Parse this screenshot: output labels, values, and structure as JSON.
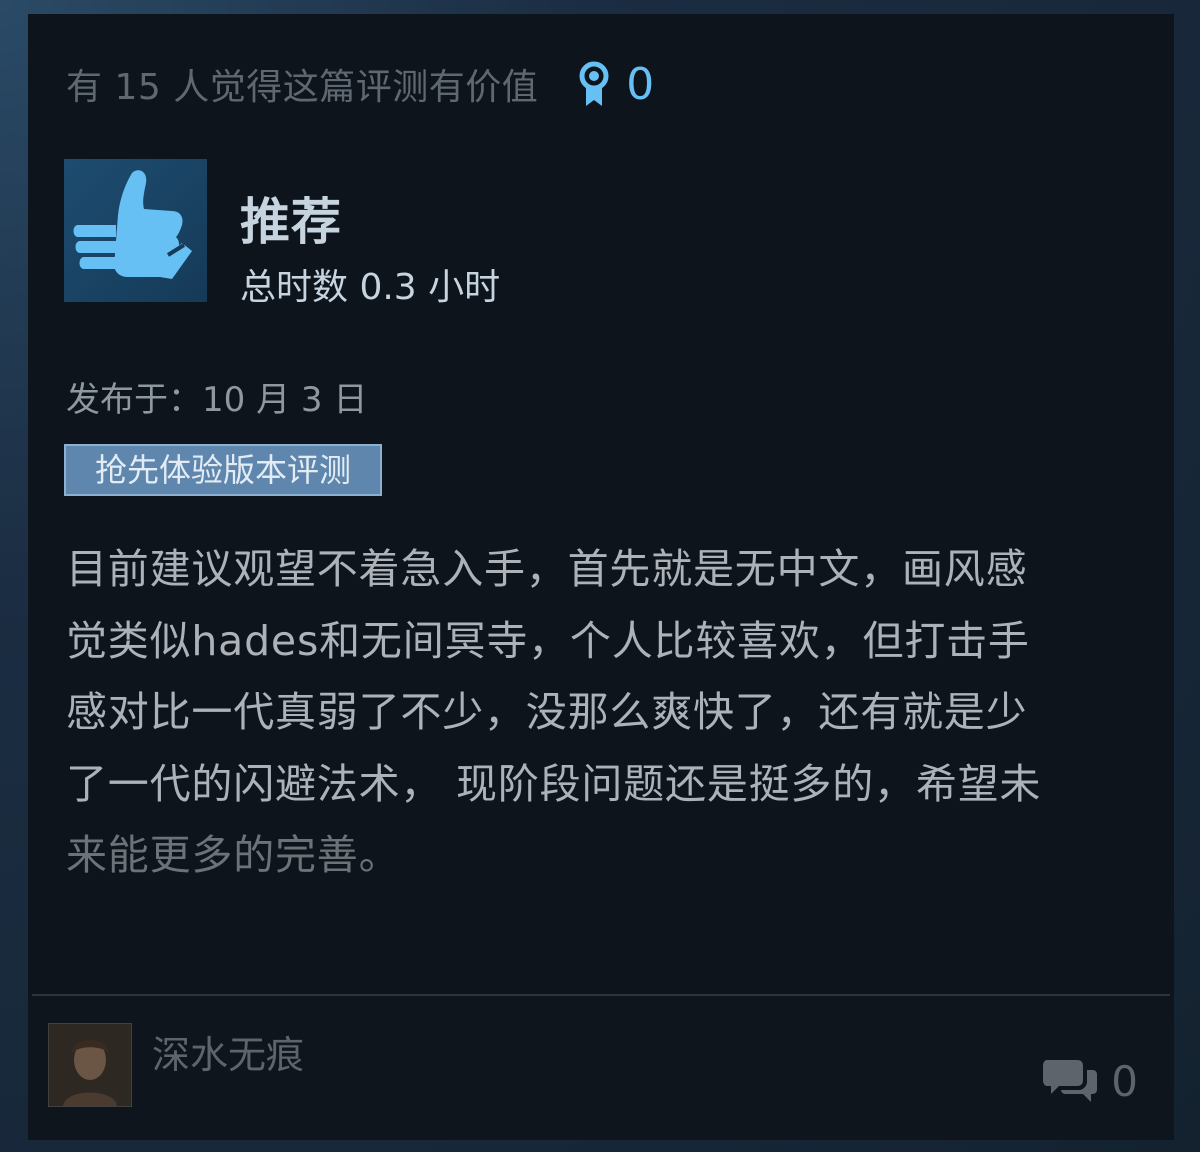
{
  "review": {
    "helpful_text": "有 15 人觉得这篇评测有价值",
    "award_count": "0",
    "recommendation": "推荐",
    "playtime": "总时数 0.3 小时",
    "posted": "发布于：10 月 3 日",
    "early_access_label": "抢先体验版本评测",
    "body_lines": [
      "目前建议观望不着急入手，首先就是无中文，画风感",
      "觉类似hades和无间冥寺，个人比较喜欢，但打击手",
      "感对比一代真弱了不少，没那么爽快了，还有就是少",
      "了一代的闪避法术， 现阶段问题还是挺多的，希望未",
      "来能更多的完善。"
    ]
  },
  "author": {
    "username": "深水无痕"
  },
  "comments": {
    "count": "0"
  },
  "colors": {
    "accent": "#66c0f4",
    "card_bg": "#0e141c",
    "badge_bg": "#5f87ae",
    "thumb_icon": "#66c0f4"
  },
  "icons": {
    "award": "award-ribbon-icon",
    "thumb": "thumbs-up-icon",
    "comment": "comment-bubbles-icon"
  }
}
